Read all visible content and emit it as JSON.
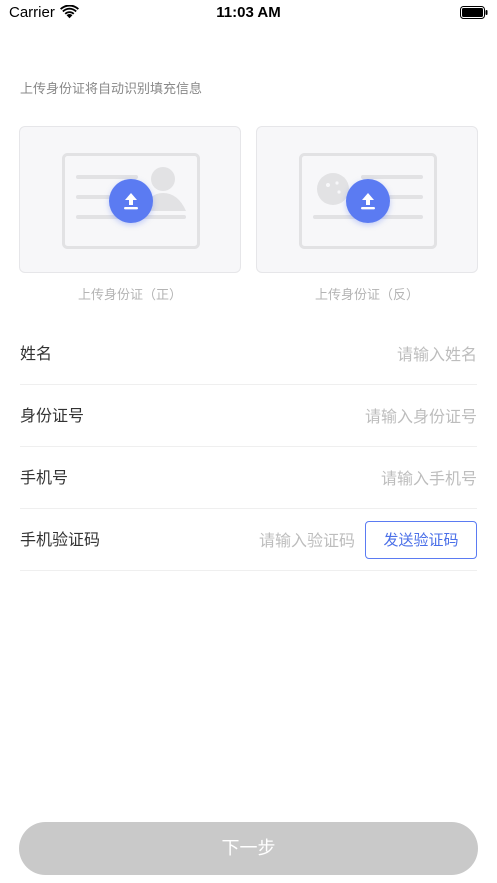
{
  "status_bar": {
    "carrier": "Carrier",
    "time": "11:03 AM",
    "wifi_icon": "wifi-icon",
    "battery_icon": "battery-icon"
  },
  "hint": "上传身份证将自动识别填充信息",
  "upload": {
    "front_caption": "上传身份证（正）",
    "back_caption": "上传身份证（反）",
    "icon": "upload-icon",
    "accent": "#5b7bf2"
  },
  "form": {
    "name_label": "姓名",
    "name_placeholder": "请输入姓名",
    "id_label": "身份证号",
    "id_placeholder": "请输入身份证号",
    "phone_label": "手机号",
    "phone_placeholder": "请输入手机号",
    "code_label": "手机验证码",
    "code_placeholder": "请输入验证码",
    "send_code": "发送验证码"
  },
  "next_button": "下一步",
  "colors": {
    "accent": "#5b7bf2",
    "disabled_button": "#c9c9c9",
    "placeholder": "#bdbdbd"
  }
}
